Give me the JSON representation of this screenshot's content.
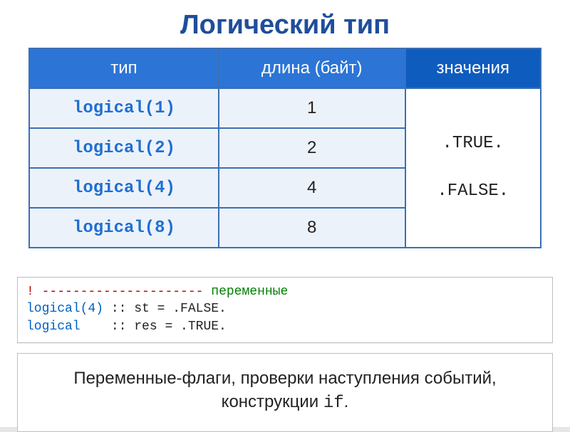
{
  "title": "Логический тип",
  "table": {
    "headers": {
      "type": "тип",
      "length": "длина (байт)",
      "values": "значения"
    },
    "rows": [
      {
        "type": "logical(1)",
        "length": "1"
      },
      {
        "type": "logical(2)",
        "length": "2"
      },
      {
        "type": "logical(4)",
        "length": "4"
      },
      {
        "type": "logical(8)",
        "length": "8"
      }
    ],
    "values_true": ".TRUE.",
    "values_false": ".FALSE."
  },
  "code": {
    "bang": "!",
    "dashes": " --------------------- ",
    "comment_word": "переменные",
    "line2_type": "logical(4)",
    "line2_rest": " :: st = .FALSE.",
    "line3_type": "logical",
    "line3_pad": "   ",
    "line3_rest": " :: res = .TRUE."
  },
  "desc": {
    "text": "Переменные-флаги, проверки наступления событий, конструкции ",
    "mono": "if",
    "tail": "."
  }
}
